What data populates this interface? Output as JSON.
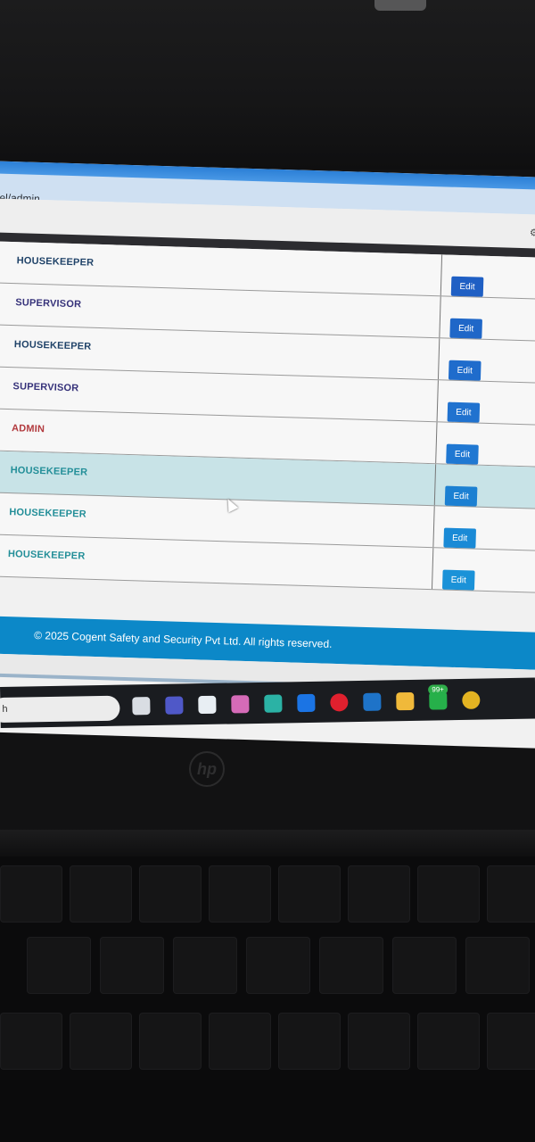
{
  "browser": {
    "address": "nel/admin"
  },
  "table": {
    "rows": [
      {
        "role": "HOUSEKEEPER",
        "tone": "housekeeper",
        "edit": "Edit",
        "btn_color": "#1f5fc4"
      },
      {
        "role": "SUPERVISOR",
        "tone": "supervisor",
        "edit": "Edit",
        "btn_color": "#1f67c8"
      },
      {
        "role": "HOUSEKEEPER",
        "tone": "housekeeper",
        "edit": "Edit",
        "btn_color": "#1f6ccc"
      },
      {
        "role": "SUPERVISOR",
        "tone": "supervisor",
        "edit": "Edit",
        "btn_color": "#2072cf"
      },
      {
        "role": "ADMIN",
        "tone": "admin",
        "edit": "Edit",
        "btn_color": "#2078d2"
      },
      {
        "role": "HOUSEKEEPER",
        "tone": "teal",
        "edit": "Edit",
        "btn_color": "#1c80d2",
        "hovered": true
      },
      {
        "role": "HOUSEKEEPER",
        "tone": "teal",
        "edit": "Edit",
        "btn_color": "#1a8ad6"
      },
      {
        "role": "HOUSEKEEPER",
        "tone": "teal",
        "edit": "Edit",
        "btn_color": "#1b92d8"
      }
    ]
  },
  "footer": {
    "text": "© 2025 Cogent Safety and Security Pvt Ltd. All rights reserved."
  },
  "taskbar": {
    "search_text": "h",
    "notification_badge": "99+",
    "icons": [
      {
        "name": "task-view-icon",
        "color": "#d9dde3"
      },
      {
        "name": "teams-icon",
        "color": "#4f58c8"
      },
      {
        "name": "widgets-icon",
        "color": "#e8eef3"
      },
      {
        "name": "copilot-icon",
        "color": "#d56bb8"
      },
      {
        "name": "edge-icon",
        "color": "#2bb2a5"
      },
      {
        "name": "dropbox-icon",
        "color": "#1b74e4"
      },
      {
        "name": "opera-icon",
        "color": "#e0202e"
      },
      {
        "name": "outlook-icon",
        "color": "#1e73c8"
      },
      {
        "name": "file-explorer-icon",
        "color": "#f0b93a"
      },
      {
        "name": "whatsapp-icon",
        "color": "#26b04a"
      },
      {
        "name": "chrome-icon",
        "color": "#e3b322"
      }
    ]
  }
}
